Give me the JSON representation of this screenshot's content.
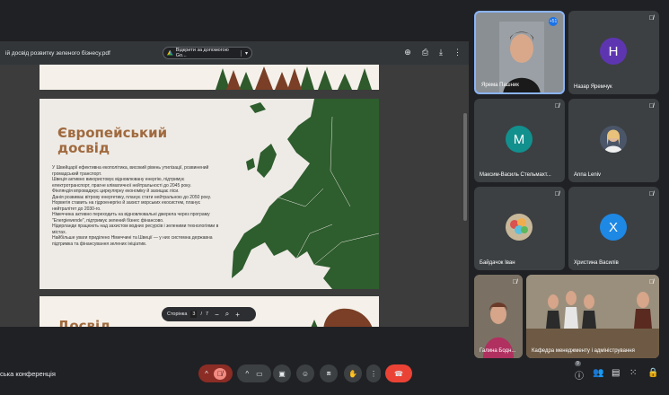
{
  "viewer": {
    "title": "ій досвід розвитку зеленого бізнесу.pdf",
    "open_with_label": "Відкрити за допомогою Go...",
    "page_label": "Сторінка",
    "page_current": "3",
    "page_sep": "/",
    "page_total": "7"
  },
  "slide": {
    "title": "Європейський досвід",
    "body": [
      "У Швейцарії ефективна екополітика, високий рівень утилізації, розвинений громадський транспорт.",
      "Швеція активно використовує відновлювану енергію, підтримує електротранспорт, прагне кліматичної нейтральності до 2045 року.",
      "Фінляндія впроваджує циркулярну економіку й захищає ліси.",
      "Данія розвиває вітрову енергетику, планує стати нейтральною до 2050 року.",
      "Норвегія ставить на гідроенергію й захист морських екосистем, планує нейтралітет до 2030-го.",
      "Німеччина активно переходить на відновлювальні джерела через програму \"Energiewende\", підтримує зелений бізнес фінансово.",
      "Нідерланди працюють над захистом водних ресурсів і зеленими технологіями в містах.",
      "Найбільше уваги приділено Німеччині та Швеції — у них системна державна підтримка та фінансування зелених ініціатив."
    ],
    "next_title": "Досвід"
  },
  "participants": [
    {
      "name": "Ярема Пашник",
      "type": "video",
      "active": true,
      "badge": "+51"
    },
    {
      "name": "Назар Яремчук",
      "type": "avatar",
      "initial": "Н",
      "color": "#5e35b1"
    },
    {
      "name": "Максим-Василь Стельмахт...",
      "type": "avatar",
      "initial": "М",
      "color": "#12908e"
    },
    {
      "name": "Anna Leniv",
      "type": "photo"
    },
    {
      "name": "Байдачок Іван",
      "type": "photo"
    },
    {
      "name": "Христина Василів",
      "type": "avatar",
      "initial": "Х",
      "color": "#1e88e5"
    },
    {
      "name": "Галина Бодн...",
      "type": "video"
    },
    {
      "name": "Кафедра менеджменту і адміністрування",
      "type": "video"
    }
  ],
  "bottom": {
    "conference_name": "ська конференція",
    "participants_count": "9"
  }
}
